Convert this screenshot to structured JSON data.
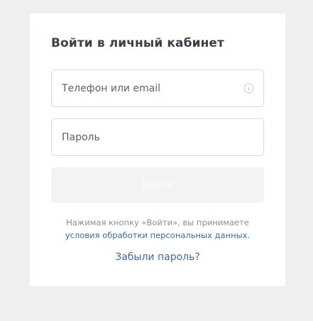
{
  "login": {
    "title": "Войти в личный кабинет",
    "phone_field": {
      "placeholder": "Телефон или email",
      "value": "",
      "icon": "info-icon"
    },
    "password_field": {
      "placeholder": "Пароль",
      "value": ""
    },
    "submit_label": "Войти",
    "consent_text": "Нажимая кнопку «Войти», вы принимаете",
    "consent_link": "условия обработки персональных данных.",
    "forgot_password": "Забыли пароль?"
  },
  "colors": {
    "page_background": "#efeff1",
    "card_background": "#ffffff",
    "title": "#3b3f47",
    "link": "#3d6aa8",
    "muted_text": "#8a8e96",
    "disabled_button": "#f3f3f5"
  }
}
